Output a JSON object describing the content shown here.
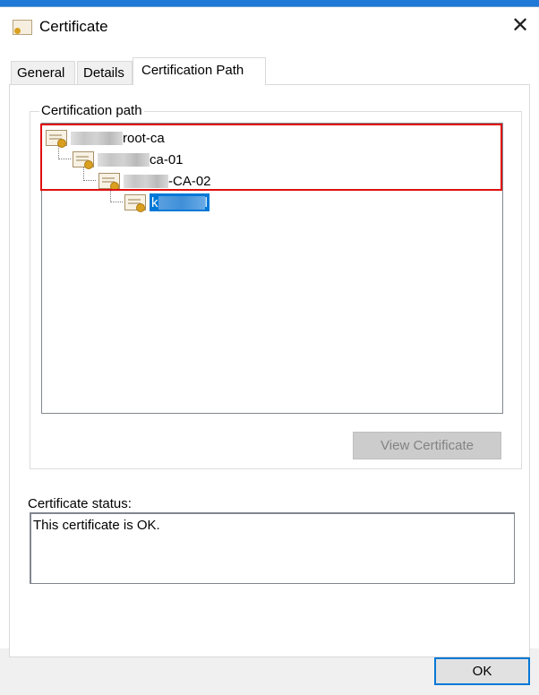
{
  "window": {
    "title": "Certificate",
    "close_icon": "close-icon"
  },
  "tabs": [
    {
      "label": "General"
    },
    {
      "label": "Details"
    },
    {
      "label": "Certification Path",
      "active": true
    }
  ],
  "certification_path": {
    "group_label": "Certification path",
    "nodes": [
      {
        "label": "root-ca",
        "level": 0
      },
      {
        "label": "ca-01",
        "level": 1
      },
      {
        "label": "-CA-02",
        "level": 2
      },
      {
        "label_start": "k",
        "label_end": "l",
        "level": 3,
        "selected": true
      }
    ],
    "view_certificate_label": "View Certificate"
  },
  "status": {
    "label": "Certificate status:",
    "text": "This certificate is OK."
  },
  "footer": {
    "ok_label": "OK"
  },
  "colors": {
    "selection": "#0078d7",
    "highlight_box": "#e01010"
  }
}
